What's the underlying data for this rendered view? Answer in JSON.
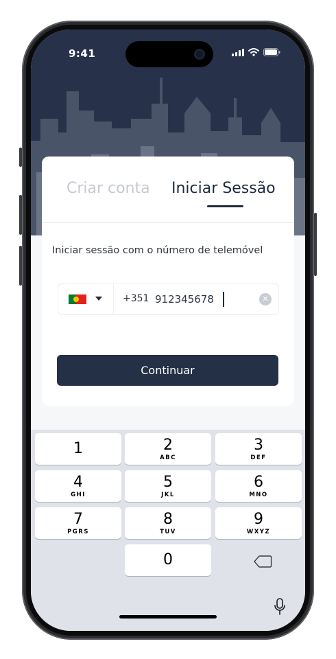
{
  "status_bar": {
    "time": "9:41"
  },
  "tabs": {
    "create_account": "Criar conta",
    "sign_in": "Iniciar Sessão"
  },
  "form": {
    "subtitle": "Iniciar sessão com o número de telemóvel",
    "country_code": "+351",
    "phone_number": "912345678",
    "continue_label": "Continuar"
  },
  "keypad": {
    "keys": [
      {
        "digit": "1",
        "letters": ""
      },
      {
        "digit": "2",
        "letters": "ABC"
      },
      {
        "digit": "3",
        "letters": "DEF"
      },
      {
        "digit": "4",
        "letters": "GHI"
      },
      {
        "digit": "5",
        "letters": "JKL"
      },
      {
        "digit": "6",
        "letters": "MNO"
      },
      {
        "digit": "7",
        "letters": "PGRS"
      },
      {
        "digit": "8",
        "letters": "TUV"
      },
      {
        "digit": "9",
        "letters": "WXYZ"
      },
      {
        "digit": "0",
        "letters": ""
      }
    ]
  },
  "colors": {
    "hero": "#27324a",
    "primary_button": "#243045",
    "accent_text": "#1f2a3d",
    "inactive_tab": "#c6cad1"
  },
  "icons": {
    "flag": "portugal-flag-icon",
    "dropdown": "caret-down-icon",
    "clear": "clear-circle-icon",
    "backspace": "backspace-icon",
    "mic": "microphone-icon"
  }
}
